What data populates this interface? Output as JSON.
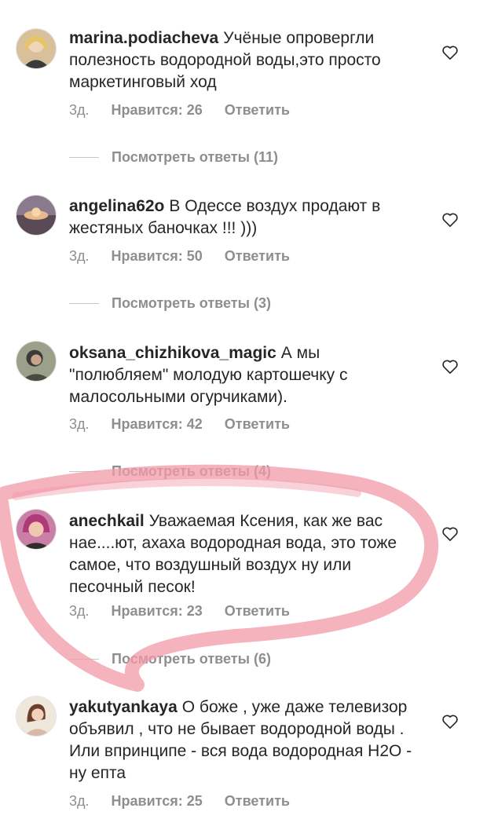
{
  "comments": [
    {
      "username": "marina.podiacheva",
      "text": "Учёные опровергли полезность водородной воды,это просто маркетинговый ход",
      "time": "3д.",
      "likes": "Нравится: 26",
      "reply": "Ответить",
      "view_replies": "Посмотреть ответы (11)"
    },
    {
      "username": "angelina62o",
      "text": "В Одессе воздух продают в жестяных баночках !!! )))",
      "time": "3д.",
      "likes": "Нравится: 50",
      "reply": "Ответить",
      "view_replies": "Посмотреть ответы (3)"
    },
    {
      "username": "oksana_chizhikova_magic",
      "text": "А мы \"полюбляем\" молодую картошечку с малосольными огурчиками).",
      "time": "3д.",
      "likes": "Нравится: 42",
      "reply": "Ответить",
      "view_replies": "Посмотреть ответы (4)"
    },
    {
      "username": "anechkail",
      "text": "Уважаемая Ксения, как же вас нае....ют, ахаха водородная вода, это тоже самое, что воздушный воздух ну или песочный песок!",
      "time": "3д.",
      "likes": "Нравится: 23",
      "reply": "Ответить",
      "view_replies": "Посмотреть ответы (6)"
    },
    {
      "username": "yakutyankaya",
      "text": "О боже , уже даже телевизор объявил , что не бывает водородной воды . Или впринципе - вся вода водородная Н2О - ну епта",
      "time": "3д.",
      "likes": "Нравится: 25",
      "reply": "Ответить"
    }
  ],
  "colors": {
    "username": "#262626",
    "meta": "#8e8e8e",
    "highlight_marker": "#f29aa8"
  },
  "icons": [
    "heart-outline-icon"
  ]
}
